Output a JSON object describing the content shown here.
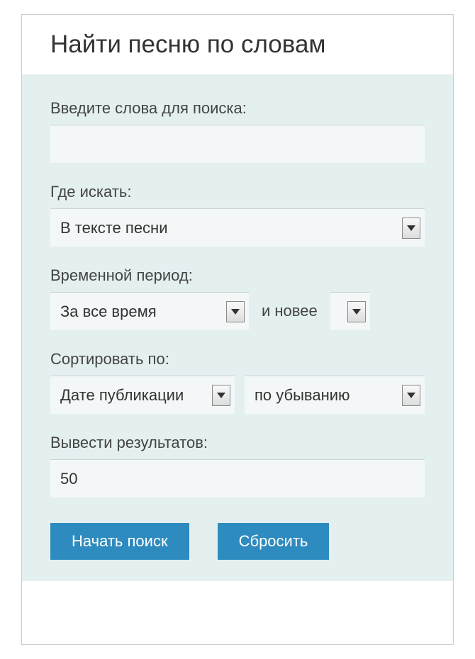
{
  "title": "Найти песню по словам",
  "form": {
    "search_words": {
      "label": "Введите слова для поиска:",
      "value": ""
    },
    "search_in": {
      "label": "Где искать:",
      "selected": "В тексте песни"
    },
    "time_period": {
      "label": "Временной период:",
      "selected": "За все время",
      "conjunction": "и новее",
      "secondary_selected": ""
    },
    "sort_by": {
      "label": "Сортировать по:",
      "selected": "Дате публикации",
      "direction": "по убыванию"
    },
    "results_count": {
      "label": "Вывести результатов:",
      "value": "50"
    },
    "buttons": {
      "search": "Начать поиск",
      "reset": "Сбросить"
    }
  }
}
